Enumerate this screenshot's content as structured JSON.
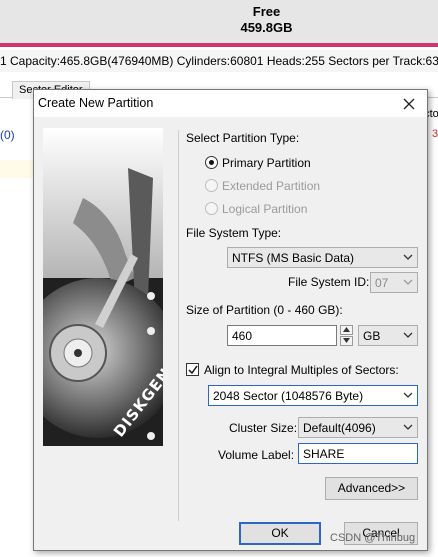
{
  "background": {
    "free_label": "Free",
    "free_size": "459.8GB",
    "disk_info": "1  Capacity:465.8GB(476940MB)  Cylinders:60801  Heads:255  Sectors per Track:63  Total",
    "tab_label": "Sector Editor",
    "left_fragment": "(0)",
    "right_fragment": "ecto",
    "right_number": "3"
  },
  "dialog": {
    "title": "Create New Partition",
    "partition_type": {
      "heading": "Select Partition Type:",
      "options": [
        {
          "label": "Primary Partition",
          "selected": true,
          "enabled": true
        },
        {
          "label": "Extended Partition",
          "selected": false,
          "enabled": false
        },
        {
          "label": "Logical Partition",
          "selected": false,
          "enabled": false
        }
      ]
    },
    "file_system": {
      "heading": "File System Type:",
      "value": "NTFS (MS Basic Data)",
      "id_label": "File System ID:",
      "id_value": "07"
    },
    "size": {
      "heading": "Size of Partition (0 - 460 GB):",
      "value": "460",
      "unit": "GB"
    },
    "align": {
      "label": "Align to Integral Multiples of Sectors:",
      "checked": true,
      "value": "2048 Sector (1048576 Byte)"
    },
    "cluster": {
      "label": "Cluster Size:",
      "value": "Default(4096)"
    },
    "volume": {
      "label": "Volume Label:",
      "value": "SHARE"
    },
    "buttons": {
      "advanced": "Advanced>>",
      "ok": "OK",
      "cancel": "Cancel"
    },
    "image_brand": "DISKGENIUS"
  },
  "watermark": "CSDN @Thinbug",
  "icons": [
    "close-icon",
    "chevron-down-icon",
    "spin-up-icon",
    "spin-down-icon",
    "checkmark-icon",
    "hard-disk-icon"
  ]
}
